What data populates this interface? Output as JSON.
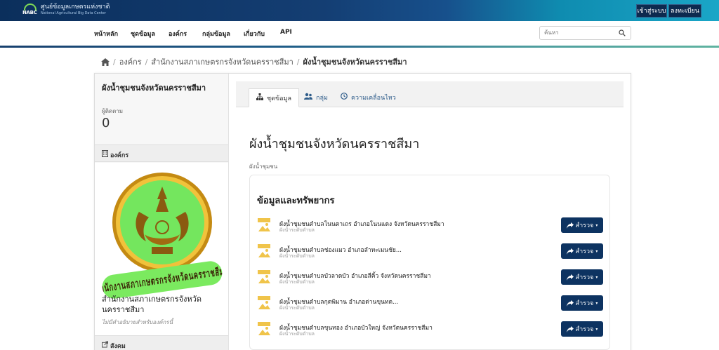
{
  "header": {
    "logo_text": "NABC",
    "brand_th": "ศูนย์ข้อมูลเกษตรแห่งชาติ",
    "brand_en": "National Agricultural Big Data Center",
    "login_label": "เข้าสู่ระบบ",
    "register_label": "ลงทะเบียน"
  },
  "nav": {
    "items": [
      "หน้าหลัก",
      "ชุดข้อมูล",
      "องค์กร",
      "กลุ่มข้อมูล",
      "เกี่ยวกับ",
      "API"
    ],
    "search_placeholder": "ค้นหา"
  },
  "breadcrumb": {
    "items": [
      "องค์กร",
      "สำนักงานสภาเกษตรกรจังหวัดนครราชสีมา",
      "ผังน้ำชุมชนจังหวัดนครราชสีมา"
    ]
  },
  "sidebar": {
    "title": "ผังน้ำชุมชนจังหวัดนครราชสีมา",
    "followers_label": "ผู้ติดตาม",
    "followers_count": "0",
    "org_section_label": "องค์กร",
    "org_name": "สำนักงานสภาเกษตรกรจังหวัดนครราชสีมา",
    "org_description": "ไม่มีคำอธิบายสำหรับองค์กรนี้",
    "social_section_label": "สังคม"
  },
  "tabs": [
    {
      "label": "ชุดข้อมูล",
      "icon": "sitemap-icon",
      "active": true
    },
    {
      "label": "กลุ่ม",
      "icon": "users-icon",
      "active": false
    },
    {
      "label": "ความเคลื่อนไหว",
      "icon": "clock-icon",
      "active": false
    }
  ],
  "dataset": {
    "title": "ผังน้ำชุมชนจังหวัดนครราชสีมา",
    "subtitle": "ผังน้ำชุมชน"
  },
  "resources": {
    "heading": "ข้อมูลและทรัพยากร",
    "explore_label": "สำรวจ",
    "items": [
      {
        "title": "ผังน้ำชุมชนตำบลโนนตาเถร อำเภอโนนแดง จังหวัดนครราชสีมา",
        "desc": "ผังน้ำระดับตำบล"
      },
      {
        "title": "ผังน้ำชุมชนตำบลช่องแมว อำเภอลำทะเมนชัย...",
        "desc": "ผังน้ำระดับตำบล"
      },
      {
        "title": "ผังน้ำชุมชนตำบลบัวลาดบัว อำเภอสีคิ้ว จังหวัดนครราชสีมา",
        "desc": "ผังน้ำระดับตำบล"
      },
      {
        "title": "ผังน้ำชุมชนตำบลกุดพิมาน อำเภอด่านขุนทด...",
        "desc": "ผังน้ำระดับตำบล"
      },
      {
        "title": "ผังน้ำชุมชนตำบลขุนทอง อำเภอบัวใหญ่ จังหวัดนครราชสีมา",
        "desc": "ผังน้ำระดับตำบล"
      }
    ]
  },
  "colors": {
    "navy_button": "#0d3361",
    "link_blue": "#2e5c8a",
    "seal_green": "#6fe05a",
    "seal_gold": "#d9a21b"
  }
}
